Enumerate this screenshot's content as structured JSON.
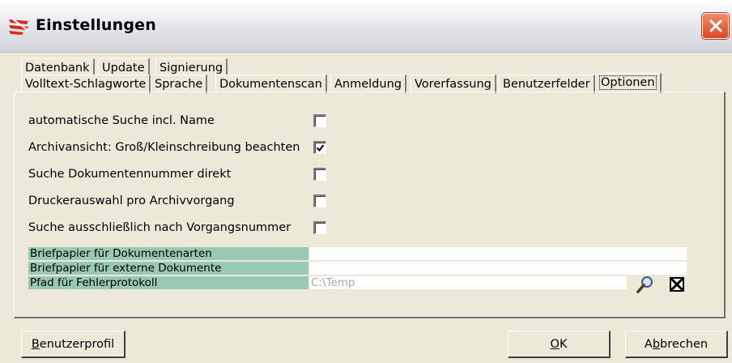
{
  "window": {
    "title": "Einstellungen"
  },
  "tabs_row1": [
    {
      "label": "Datenbank"
    },
    {
      "label": "Update"
    },
    {
      "label": "Signierung"
    }
  ],
  "tabs_row2": [
    {
      "label": "Volltext-Schlagworte"
    },
    {
      "label": "Sprache"
    },
    {
      "label": "Dokumentenscan"
    },
    {
      "label": "Anmeldung"
    },
    {
      "label": "Vorerfassung"
    },
    {
      "label": "Benutzerfelder"
    },
    {
      "label": "Optionen",
      "active": true
    }
  ],
  "options": [
    {
      "label": "automatische Suche incl. Name",
      "checked": false
    },
    {
      "label": "Archivansicht: Groß/Kleinschreibung beachten",
      "checked": true
    },
    {
      "label": "Suche Dokumentennummer direkt",
      "checked": false
    },
    {
      "label": "Druckerauswahl pro Archivvorgang",
      "checked": false
    },
    {
      "label": "Suche ausschließlich nach Vorgangsnummer",
      "checked": false
    }
  ],
  "fields": [
    {
      "label": "Briefpapier für Dokumentenarten",
      "value": ""
    },
    {
      "label": "Briefpapier für externe Dokumente",
      "value": ""
    },
    {
      "label": "Pfad für Fehlerprotokoll",
      "value": "C:\\Temp"
    }
  ],
  "buttons": {
    "profile_prefix": "B",
    "profile_rest": "enutzerprofil",
    "ok_prefix": "O",
    "ok_rest": "K",
    "cancel_a": "A",
    "cancel_b": "b",
    "cancel_rest": "brechen"
  },
  "colors": {
    "field_label_bg": "#99c8b4",
    "dialog_bg": "#ece9d8",
    "close_red": "#d8492b"
  },
  "icons": {
    "app": "app-logo-icon",
    "close": "close-icon",
    "search": "magnifier-icon",
    "clear": "clear-icon"
  }
}
